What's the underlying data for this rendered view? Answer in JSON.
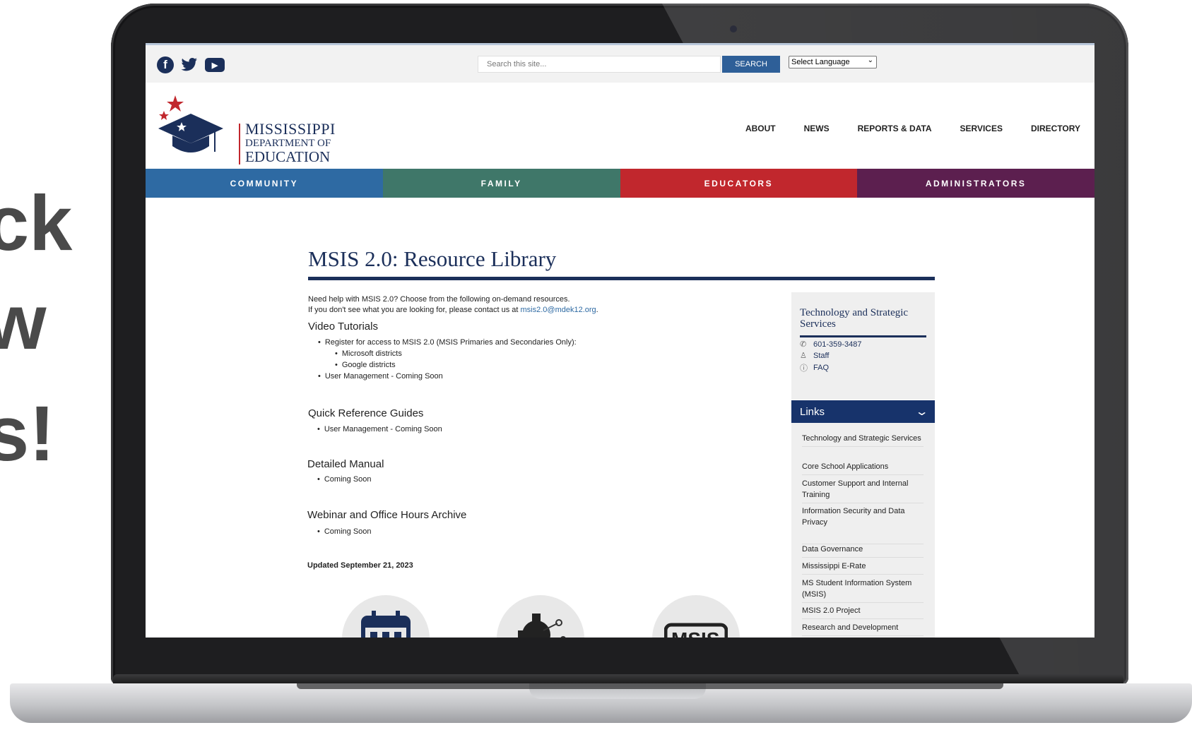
{
  "side_text": [
    "ck",
    "w",
    "s!"
  ],
  "topbar": {
    "search_placeholder": "Search this site...",
    "search_button": "SEARCH",
    "language": "Select Language",
    "social": [
      {
        "icon": "facebook-icon",
        "glyph": "f"
      },
      {
        "icon": "twitter-icon",
        "glyph": "🐦"
      },
      {
        "icon": "youtube-icon",
        "glyph": "▶"
      }
    ]
  },
  "logo": {
    "line1": "MISSISSIPPI",
    "line2": "DEPARTMENT OF",
    "line3": "EDUCATION",
    "colors": {
      "navy": "#1b2f5a",
      "red": "#c1272d"
    }
  },
  "main_nav": [
    "ABOUT",
    "NEWS",
    "REPORTS & DATA",
    "SERVICES",
    "DIRECTORY"
  ],
  "audience_nav": [
    {
      "label": "COMMUNITY",
      "color": "#2e6aa3"
    },
    {
      "label": "FAMILY",
      "color": "#3f7769"
    },
    {
      "label": "EDUCATORS",
      "color": "#c1272d"
    },
    {
      "label": "ADMINISTRATORS",
      "color": "#5c1f4f"
    }
  ],
  "page": {
    "title": "MSIS 2.0: Resource Library",
    "intro1": "Need help with MSIS 2.0? Choose from the following on-demand resources.",
    "intro2_prefix": "If you don't see what you are looking for, please contact us at ",
    "intro2_email": "msis2.0@mdek12.org",
    "intro2_suffix": ".",
    "sections": {
      "video": {
        "heading": "Video Tutorials",
        "item1": "Register for access to MSIS 2.0 (MSIS Primaries and Secondaries Only):",
        "sub1": "Microsoft districts",
        "sub2": "Google districts",
        "item2": "User Management - Coming Soon"
      },
      "quick": {
        "heading": "Quick Reference Guides",
        "item1": "User Management - Coming Soon"
      },
      "manual": {
        "heading": "Detailed Manual",
        "item1": "Coming Soon"
      },
      "webinar": {
        "heading": "Webinar and Office Hours Archive",
        "item1": "Coming Soon"
      }
    },
    "updated": "Updated September 21, 2023",
    "icons": [
      "calendar-icon",
      "gear-circuit-icon",
      "msis-logo-icon"
    ]
  },
  "sidebar": {
    "title": "Technology and Strategic Services",
    "phone": "601-359-3487",
    "staff": "Staff",
    "faq": "FAQ",
    "links_heading": "Links",
    "links": [
      "Technology and Strategic Services",
      "Core School Applications",
      "Customer Support and Internal Training",
      "Information Security and Data Privacy",
      "Data Governance",
      "Mississippi E-Rate",
      "MS Student Information System (MSIS)",
      "MSIS 2.0 Project",
      "Research and Development"
    ]
  }
}
